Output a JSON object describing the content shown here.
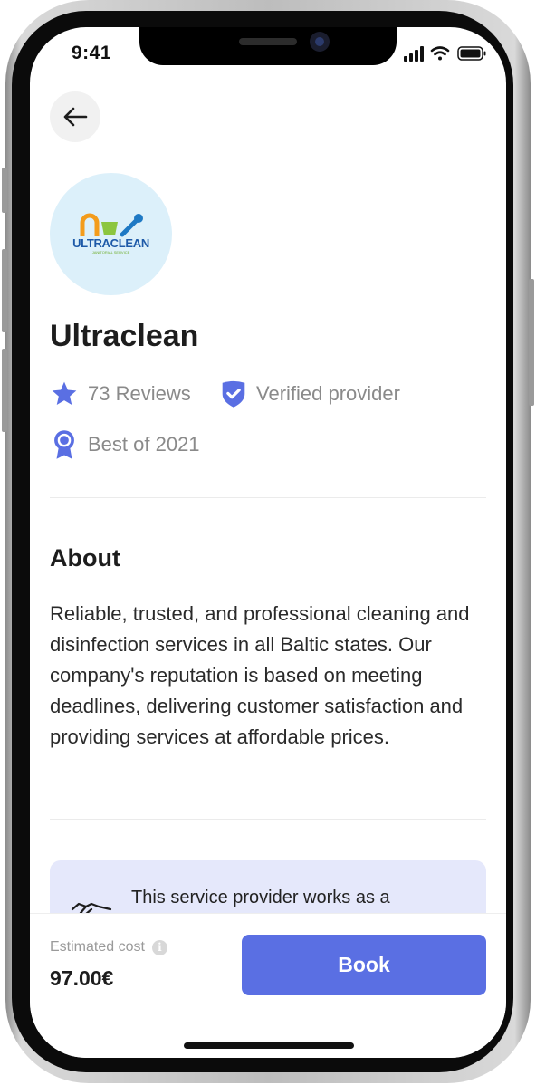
{
  "status_bar": {
    "time": "9:41"
  },
  "provider": {
    "name": "Ultraclean",
    "logo_text": "ULTRACLEAN",
    "logo_subtext": "JANITORIAL SERVICE",
    "reviews": "73 Reviews",
    "verified": "Verified provider",
    "award": "Best of 2021"
  },
  "about": {
    "title": "About",
    "text": "Reliable, trusted, and professional cleaning and disinfection services in all Baltic states. Our company's reputation is based on meeting deadlines, delivering customer satisfaction and providing services at affordable prices."
  },
  "info_card": {
    "text": "This service provider works as a"
  },
  "footer": {
    "estimated_label": "Estimated cost",
    "price": "97.00€",
    "book_label": "Book"
  },
  "icons": {
    "back": "arrow-left-icon",
    "star": "star-icon",
    "verified": "shield-check-icon",
    "award": "ribbon-badge-icon",
    "handshake": "handshake-icon",
    "info": "info-icon"
  },
  "colors": {
    "accent": "#5a6fe3",
    "logo_bg": "#dcf0fa",
    "card_bg": "#e5e8fb",
    "muted_text": "#8a8a8a"
  }
}
